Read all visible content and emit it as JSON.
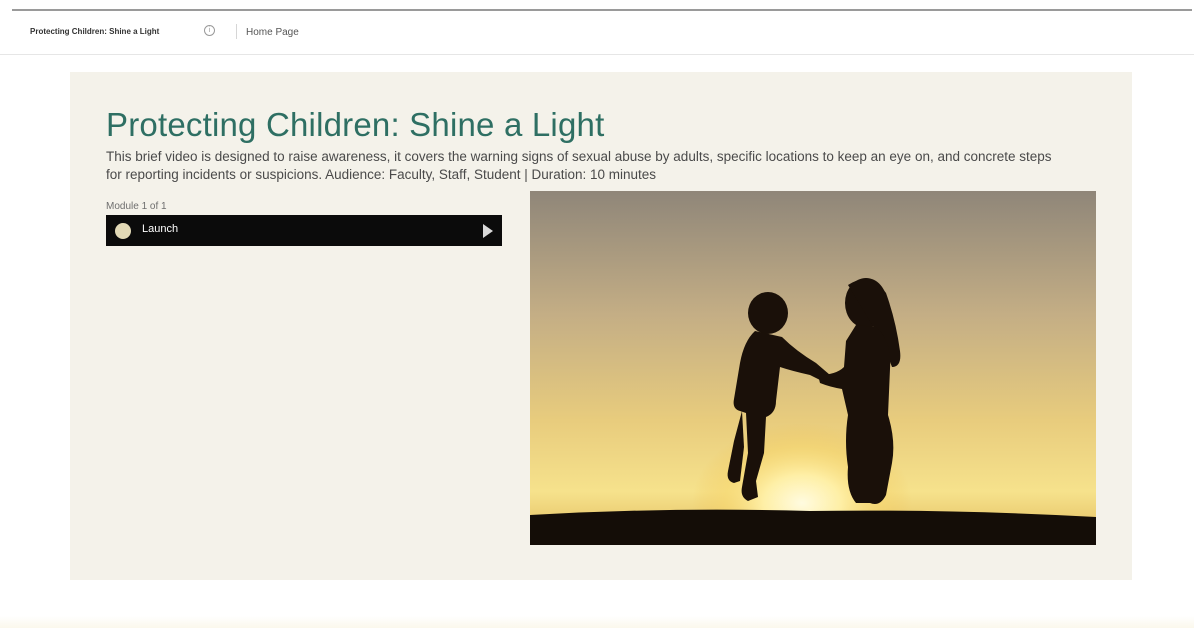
{
  "breadcrumb": {
    "course_title": "Protecting Children: Shine a Light",
    "info_icon": "info-circle-icon",
    "home_link": "Home Page"
  },
  "course": {
    "title": "Protecting Children: Shine a Light",
    "description": "This brief video is designed to raise awareness, it covers the warning signs of sexual abuse by adults, specific locations to keep an eye on, and concrete steps for reporting incidents or suspicions. Audience: Faculty, Staff, Student | Duration: 10 minutes",
    "module_label": "Module 1 of 1",
    "launch_label": "Launch",
    "launch_icon": "play-icon"
  },
  "colors": {
    "title_green": "#2e6f63",
    "panel_bg": "#f4f2ea",
    "launch_bar": "#0b0b0b"
  }
}
